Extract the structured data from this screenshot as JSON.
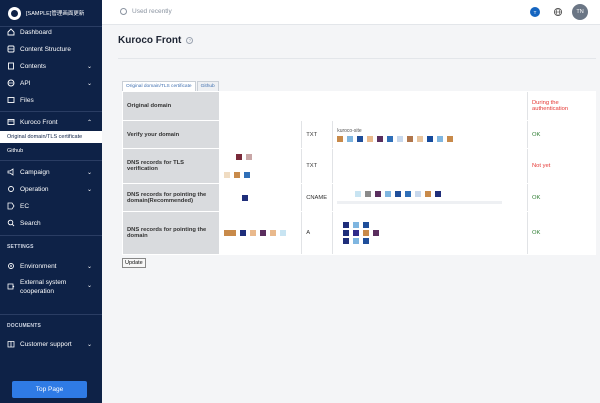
{
  "sidebar": {
    "brand": "[SAMPLE]管理画面更新",
    "items": [
      {
        "label": "Dashboard",
        "icon": "home-icon"
      },
      {
        "label": "Content Structure",
        "icon": "database-icon"
      },
      {
        "label": "Contents",
        "icon": "document-icon"
      },
      {
        "label": "API",
        "icon": "globe-icon"
      },
      {
        "label": "Files",
        "icon": "image-icon"
      },
      {
        "label": "Kuroco Front",
        "icon": "window-icon"
      },
      {
        "label": "Campaign",
        "icon": "megaphone-icon"
      },
      {
        "label": "Operation",
        "icon": "settings-icon"
      },
      {
        "label": "EC",
        "icon": "tag-icon"
      },
      {
        "label": "Search",
        "icon": "search-icon"
      },
      {
        "label": "Environment",
        "icon": "gear-icon"
      },
      {
        "label": "External system cooperation",
        "icon": "puzzle-icon"
      },
      {
        "label": "Customer support",
        "icon": "book-icon"
      }
    ],
    "sub_items": [
      "Original domain/TLS certificate",
      "Github"
    ],
    "sections": [
      "SETTINGS",
      "DOCUMENTS"
    ],
    "top_page_button": "Top Page"
  },
  "header": {
    "recent": "Used recently",
    "badge": "T",
    "avatar": "TN"
  },
  "main": {
    "title": "Kuroco Front",
    "tabs": [
      "Original domain/TLS certificate",
      "Github"
    ],
    "rows": [
      {
        "label": "Original domain",
        "type": "",
        "value": "",
        "status": "During the authentication",
        "status_color": "red"
      },
      {
        "label": "Verify your domain",
        "type": "TXT",
        "value": "kuroco-site",
        "status": "OK",
        "status_color": "green"
      },
      {
        "label": "DNS records for TLS verification",
        "type": "TXT",
        "value": "",
        "status": "Not yet",
        "status_color": "red"
      },
      {
        "label": "DNS records for pointing the domain(Recommended)",
        "type": "CNAME",
        "value": "",
        "status": "OK",
        "status_color": "green"
      },
      {
        "label": "DNS records for pointing the domain",
        "type": "A",
        "value": "",
        "status": "OK",
        "status_color": "green"
      }
    ],
    "update_button": "Update"
  },
  "colors": {
    "sidebar_bg": "#0e2247",
    "accent": "#2f7be5",
    "ok": "#2e7d32",
    "error": "#e53935"
  }
}
